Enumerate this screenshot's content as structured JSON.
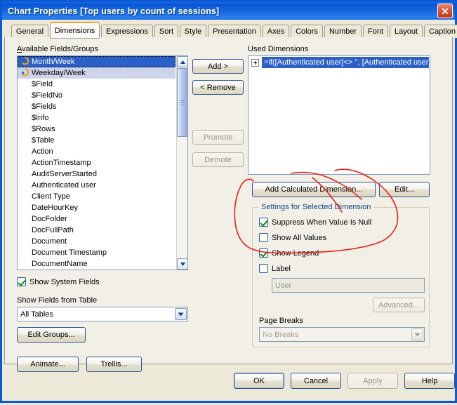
{
  "window": {
    "title": "Chart Properties [Top users by count of sessions]",
    "close_label": "✕",
    "titlebar_color": "#0a54d6",
    "accent_tab_color": "#f0a830"
  },
  "tabs": [
    {
      "label": "General",
      "active": false
    },
    {
      "label": "Dimensions",
      "active": true
    },
    {
      "label": "Expressions",
      "active": false
    },
    {
      "label": "Sort",
      "active": false
    },
    {
      "label": "Style",
      "active": false
    },
    {
      "label": "Presentation",
      "active": false
    },
    {
      "label": "Axes",
      "active": false
    },
    {
      "label": "Colors",
      "active": false
    },
    {
      "label": "Number",
      "active": false
    },
    {
      "label": "Font",
      "active": false
    },
    {
      "label": "Layout",
      "active": false
    },
    {
      "label": "Caption",
      "active": false
    }
  ],
  "available": {
    "label": "Available Fields/Groups",
    "items": [
      {
        "text": "Month/Week",
        "icon": "cyclic-group-icon",
        "state": "selected"
      },
      {
        "text": "Weekday/Week",
        "icon": "cyclic-group-icon",
        "state": "highlighted"
      },
      {
        "text": "$Field",
        "icon": "",
        "state": ""
      },
      {
        "text": "$FieldNo",
        "icon": "",
        "state": ""
      },
      {
        "text": "$Fields",
        "icon": "",
        "state": ""
      },
      {
        "text": "$Info",
        "icon": "",
        "state": ""
      },
      {
        "text": "$Rows",
        "icon": "",
        "state": ""
      },
      {
        "text": "$Table",
        "icon": "",
        "state": ""
      },
      {
        "text": "Action",
        "icon": "",
        "state": ""
      },
      {
        "text": "ActionTimestamp",
        "icon": "",
        "state": ""
      },
      {
        "text": "AuditServerStarted",
        "icon": "",
        "state": ""
      },
      {
        "text": "Authenticated user",
        "icon": "",
        "state": ""
      },
      {
        "text": "Client Type",
        "icon": "",
        "state": ""
      },
      {
        "text": "DateHourKey",
        "icon": "",
        "state": ""
      },
      {
        "text": "DocFolder",
        "icon": "",
        "state": ""
      },
      {
        "text": "DocFullPath",
        "icon": "",
        "state": ""
      },
      {
        "text": "Document",
        "icon": "",
        "state": ""
      },
      {
        "text": "Document Timestamp",
        "icon": "",
        "state": ""
      },
      {
        "text": "DocumentName",
        "icon": "",
        "state": ""
      }
    ]
  },
  "transfer": {
    "add_label": "Add >",
    "remove_label": "< Remove",
    "promote_label": "Promote",
    "demote_label": "Demote"
  },
  "used": {
    "label": "Used Dimensions",
    "items": [
      {
        "text": "=if([Authenticated user]<> '', [Authenticated user],",
        "expandable": true,
        "selected": true
      }
    ]
  },
  "dimension_actions": {
    "add_calculated_label": "Add Calculated Dimension...",
    "edit_label": "Edit..."
  },
  "settings": {
    "group_title": "Settings for Selected Dimension",
    "suppress_null_label": "Suppress When Value Is Null",
    "suppress_null_checked": true,
    "show_all_values_label": "Show All Values",
    "show_all_values_checked": false,
    "show_legend_label": "Show Legend",
    "show_legend_checked": true,
    "label_checkbox_label": "Label",
    "label_checkbox_checked": false,
    "label_value": "User",
    "advanced_label": "Advanced...",
    "page_breaks_label": "Page Breaks",
    "page_breaks_value": "No Breaks"
  },
  "left_bottom": {
    "show_system_fields_label": "Show System Fields",
    "show_system_fields_checked": true,
    "show_fields_from_table_label": "Show Fields from Table",
    "table_filter_value": "All Tables",
    "edit_groups_label": "Edit Groups...",
    "animate_label": "Animate...",
    "trellis_label": "Trellis..."
  },
  "footer": {
    "ok_label": "OK",
    "cancel_label": "Cancel",
    "apply_label": "Apply",
    "apply_disabled": true,
    "help_label": "Help"
  },
  "annotation": {
    "type": "hand-drawn-ellipse",
    "color": "#e8201a",
    "description": "red hand-drawn circle around Add Calculated Dimension and the Settings checkboxes"
  }
}
